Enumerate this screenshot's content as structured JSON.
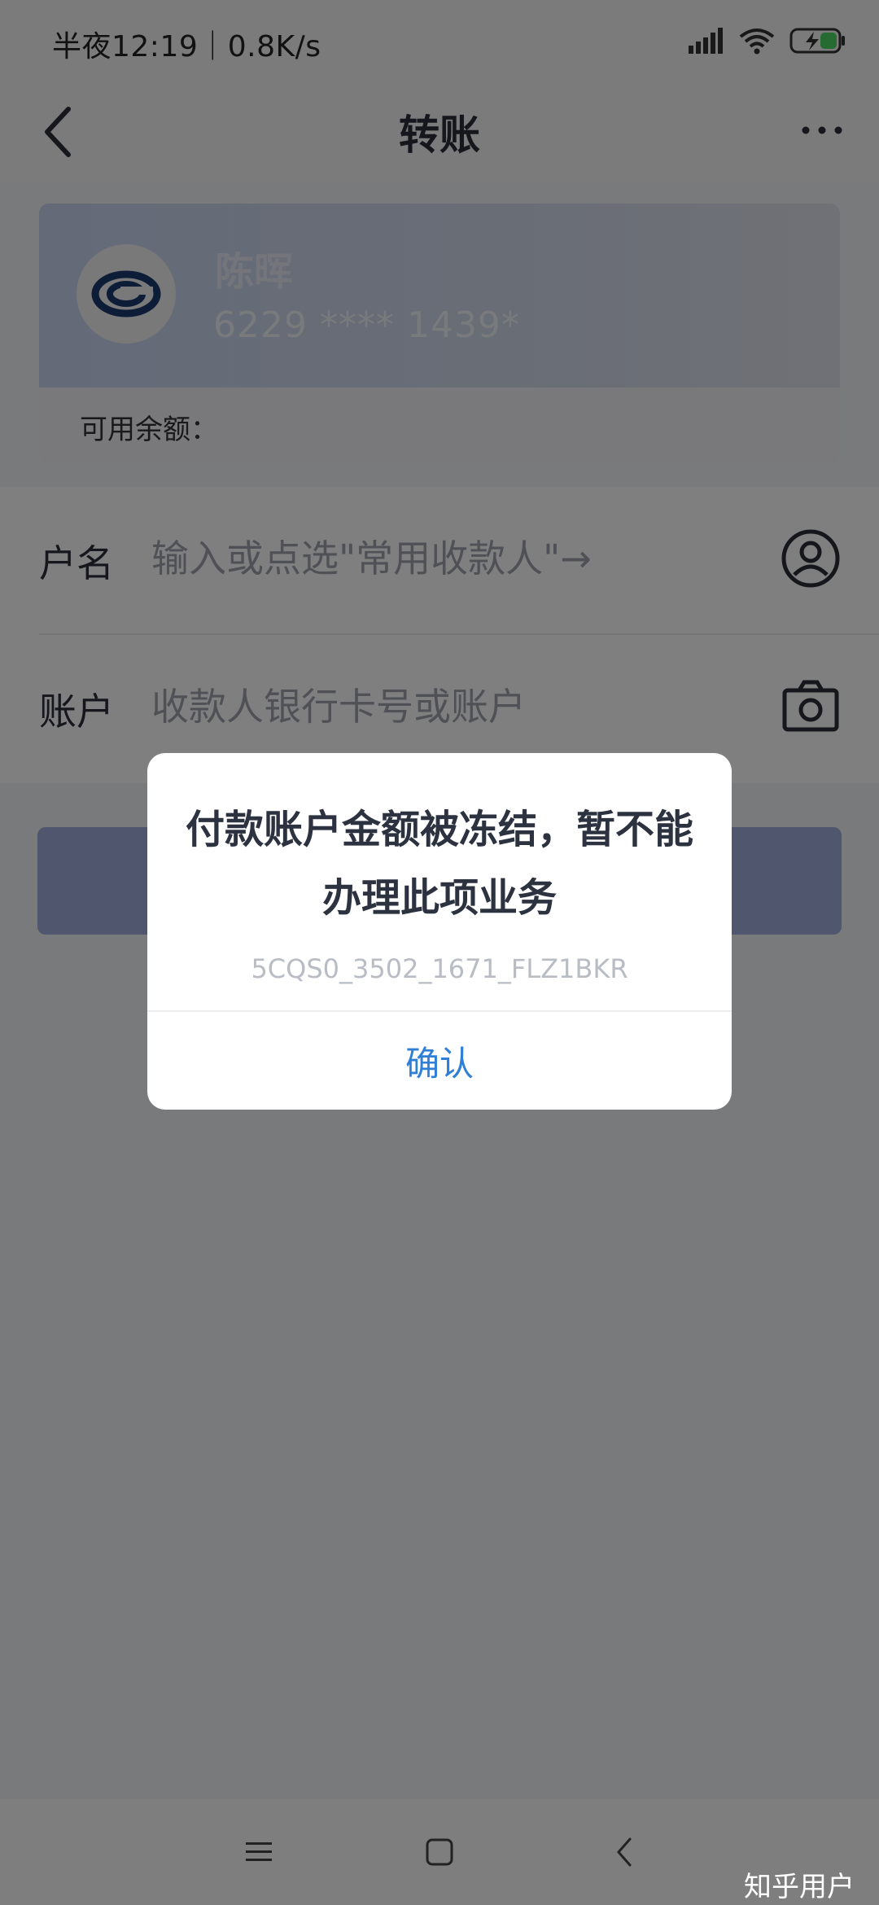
{
  "status_bar": {
    "time_speed": "半夜12:19｜0.8K/s",
    "icons": [
      "signal-icon",
      "wifi-icon",
      "battery-charging-icon"
    ]
  },
  "header": {
    "title": "转账",
    "back_icon": "chevron-left-icon",
    "more_icon": "more-dots-icon"
  },
  "account_card": {
    "name": "陈晖",
    "card_number": "6229 **** 1439*",
    "balance_label": "可用余额："
  },
  "form": {
    "name_label": "户名",
    "name_placeholder": "输入或点选\"常用收款人\"→",
    "account_label": "账户",
    "account_placeholder": "收款人银行卡号或账户",
    "contact_icon": "user-circle-icon",
    "camera_icon": "camera-icon"
  },
  "dialog": {
    "message": "付款账户金额被冻结，暂不能办理此项业务",
    "code": "5CQS0_3502_1671_FLZ1BKR",
    "confirm_label": "确认"
  },
  "nav_bar": {
    "icons": [
      "menu-icon",
      "home-square-icon",
      "back-chevron-icon"
    ]
  },
  "watermark": "知乎用户",
  "colors": {
    "accent": "#2f7fd8",
    "button": "#9eacdb",
    "card_gradient": "#c9d5f1"
  }
}
